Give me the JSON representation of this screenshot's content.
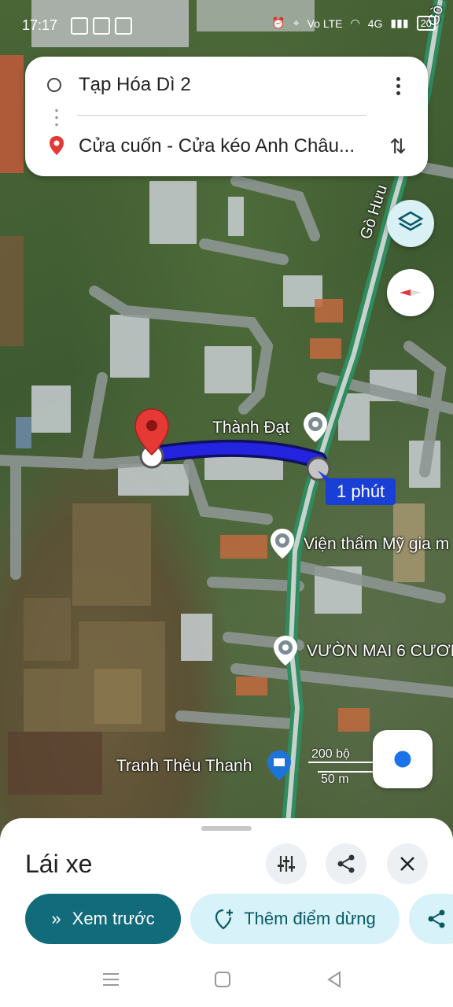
{
  "status_bar": {
    "time": "17:17",
    "network": "Vo LTE",
    "signal": "4G",
    "battery": "20"
  },
  "route": {
    "origin": "Tạp Hóa Dì 2",
    "destination": "Cửa cuốn - Cửa kéo Anh Châu..."
  },
  "map": {
    "road_label": "Gò Hưu",
    "road_label_top": "Gò",
    "eta_badge": "1 phút",
    "places": [
      {
        "name": "Thành Đạt"
      },
      {
        "name": "Viện thẩm Mỹ gia m"
      },
      {
        "name": "VƯỜN MAI 6 CƯƠN"
      },
      {
        "name": "Tranh Thêu Thanh"
      }
    ],
    "scale_top": "200 bộ",
    "scale_bottom": "50 m",
    "route_color": "#2424e0"
  },
  "sheet": {
    "title": "Lái xe",
    "preview_label": "Xem trước",
    "add_stop_label": "Thêm điểm dừng"
  }
}
